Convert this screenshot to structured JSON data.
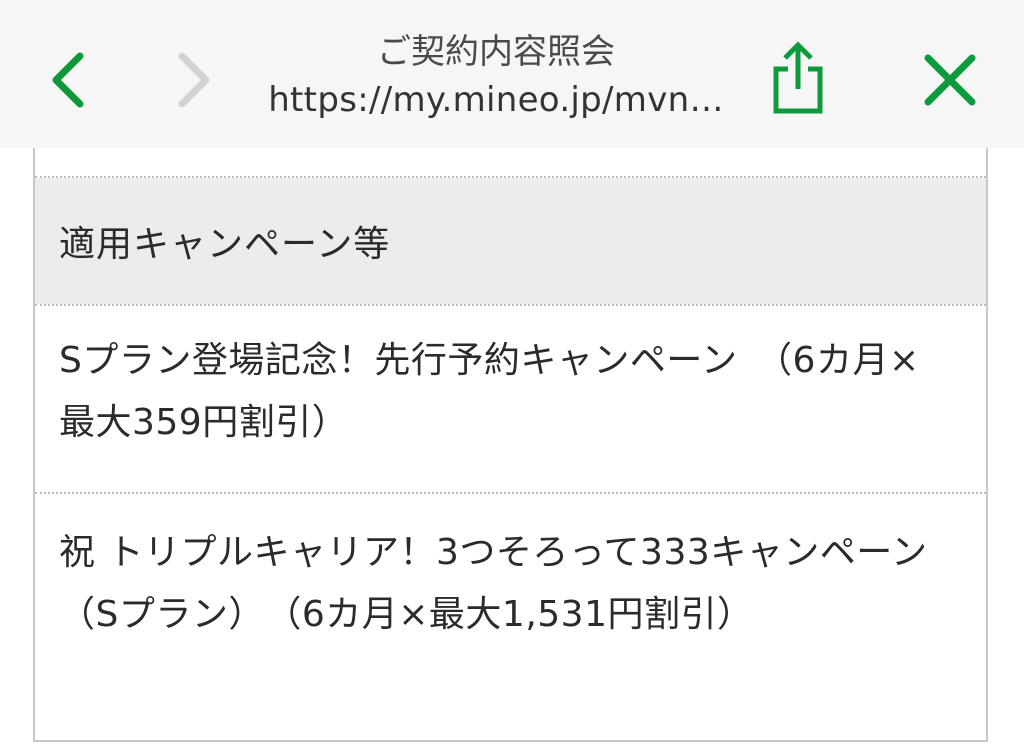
{
  "header": {
    "title": "ご契約内容照会",
    "url": "https://my.mineo.jp/mvn…",
    "icons": {
      "back": "chevron-left-icon",
      "forward": "chevron-right-icon",
      "share": "share-icon",
      "close": "close-icon"
    },
    "colors": {
      "accent_green": "#0d9a3a",
      "disabled_gray": "#d2d2d2"
    }
  },
  "section": {
    "label": "適用キャンペーン等"
  },
  "campaigns": [
    {
      "text": "Sプラン登場記念！先行予約キャンペーン　（6カ月×最大359円割引）"
    },
    {
      "text": "祝 トリプルキャリア！3つそろって333キャンペーン（Sプラン）　（6カ月×最大1,531円割引）"
    }
  ]
}
